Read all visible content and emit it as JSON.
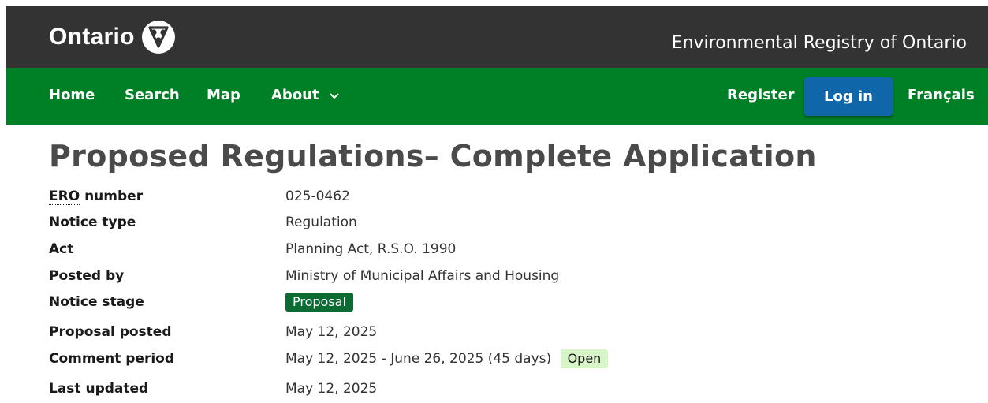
{
  "header": {
    "brand": "Ontario",
    "logo_icon": "ontario-trillium-icon",
    "registry_title": "Environmental Registry of Ontario"
  },
  "nav": {
    "home": "Home",
    "search": "Search",
    "map": "Map",
    "about": "About",
    "register": "Register",
    "login": "Log in",
    "language": "Français"
  },
  "colors": {
    "topbar": "#333333",
    "navbar": "#008026",
    "login_button": "#0f67a9",
    "proposal_badge": "#0b6b32",
    "open_badge": "#d8f5c8"
  },
  "notice": {
    "title": "Proposed Regulations– Complete Application",
    "fields": {
      "ero_abbr": "ERO",
      "ero_label_rest": " number",
      "ero_number": "025-0462",
      "notice_type_label": "Notice type",
      "notice_type": "Regulation",
      "act_label": "Act",
      "act": "Planning Act, R.S.O. 1990",
      "posted_by_label": "Posted by",
      "posted_by": "Ministry of Municipal Affairs and Housing",
      "notice_stage_label": "Notice stage",
      "notice_stage": "Proposal",
      "proposal_posted_label": "Proposal posted",
      "proposal_posted": "May 12, 2025",
      "comment_period_label": "Comment period",
      "comment_period": "May 12, 2025 - June 26, 2025 (45 days)",
      "comment_status": "Open",
      "last_updated_label": "Last updated",
      "last_updated": "May 12, 2025"
    }
  }
}
